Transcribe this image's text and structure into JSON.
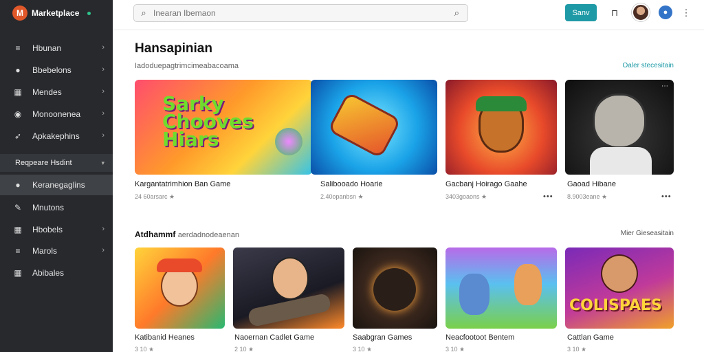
{
  "sidebar": {
    "brand": "Marketplace",
    "items": [
      {
        "label": "Hbunan",
        "icon": "list-icon",
        "glyph": "≡",
        "chevron": "›"
      },
      {
        "label": "Bbebelons",
        "icon": "person-icon",
        "glyph": "●",
        "chevron": "›"
      },
      {
        "label": "Mendes",
        "icon": "grid-icon",
        "glyph": "▦",
        "chevron": "›"
      },
      {
        "label": "Monoonenea",
        "icon": "globe-icon",
        "glyph": "◉",
        "chevron": "›"
      },
      {
        "label": "Apkakephins",
        "icon": "rocket-icon",
        "glyph": "➶",
        "chevron": "›"
      }
    ],
    "section": {
      "label": "Reqpeare Hsdint",
      "chevron": "▾"
    },
    "items2": [
      {
        "label": "Keranegaglins",
        "icon": "person-icon",
        "glyph": "●",
        "chevron": ""
      },
      {
        "label": "Mnutons",
        "icon": "tag-icon",
        "glyph": "✎",
        "chevron": ""
      },
      {
        "label": "Hbobels",
        "icon": "grid-icon",
        "glyph": "▦",
        "chevron": "›"
      },
      {
        "label": "Marols",
        "icon": "list-icon",
        "glyph": "≡",
        "chevron": "›"
      },
      {
        "label": "Abibales",
        "icon": "grid-icon",
        "glyph": "▦",
        "chevron": ""
      }
    ]
  },
  "topbar": {
    "search_placeholder": "Inearan Ibemaon",
    "save_label": "Sanv",
    "icons": [
      "bookmark-icon",
      "avatar",
      "user-icon",
      "more-icon"
    ]
  },
  "section1": {
    "title": "Hansapinian",
    "subtitle": "Iadoduepagtrimcimeabacoama",
    "see_all": "Oaler stecesitain",
    "cards": [
      {
        "title": "Kargantatrimhion Ban Game",
        "meta": "24 60arsarc ★",
        "thumb_text": "Sarky Chooves Hiars"
      },
      {
        "title": "Salibooado Hoarie",
        "meta": "2.40opanbsn ★",
        "thumb_text": ""
      },
      {
        "title": "Gacbanj Hoirago Gaahe",
        "meta": "3403goaons ★",
        "thumb_text": ""
      },
      {
        "title": "Gaoad Hibane",
        "meta": "8.9003eane ★",
        "thumb_text": ""
      }
    ]
  },
  "section2": {
    "title": "Atdhammf",
    "subtitle": "aerdadnodeaenan",
    "see_all": "Mier Gieseasitain",
    "cards": [
      {
        "title": "Katibanid Heanes",
        "meta": "3 10 ★",
        "thumb_text": ""
      },
      {
        "title": "Naoernan Cadlet Game",
        "meta": "2 10 ★",
        "thumb_text": ""
      },
      {
        "title": "Saabgran Games",
        "meta": "3 10 ★",
        "thumb_text": ""
      },
      {
        "title": "Neacfootoot Bentem",
        "meta": "3 10 ★",
        "thumb_text": ""
      },
      {
        "title": "Cattlan Game",
        "meta": "3 10 ★",
        "thumb_text": "COLISPAES"
      }
    ]
  }
}
